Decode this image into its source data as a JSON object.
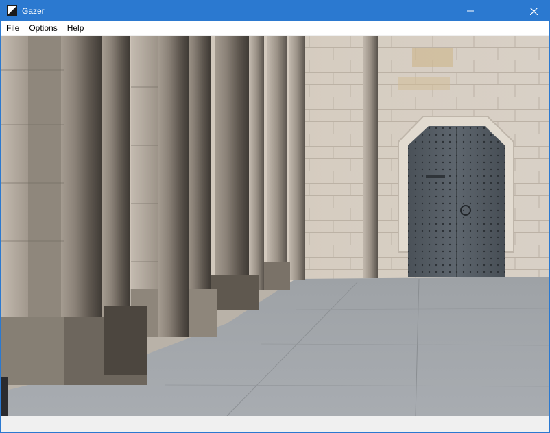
{
  "window": {
    "title": "Gazer",
    "icon": "app-icon",
    "controls": [
      "minimize-icon",
      "maximize-icon",
      "close-icon"
    ]
  },
  "menu": {
    "items": [
      "File",
      "Options",
      "Help"
    ]
  },
  "image": {
    "description_icon": "photo-viewer-canvas"
  },
  "colors": {
    "titlebar": "#2b79d0",
    "menubar": "#ffffff",
    "frame": "#f0f0f0"
  }
}
